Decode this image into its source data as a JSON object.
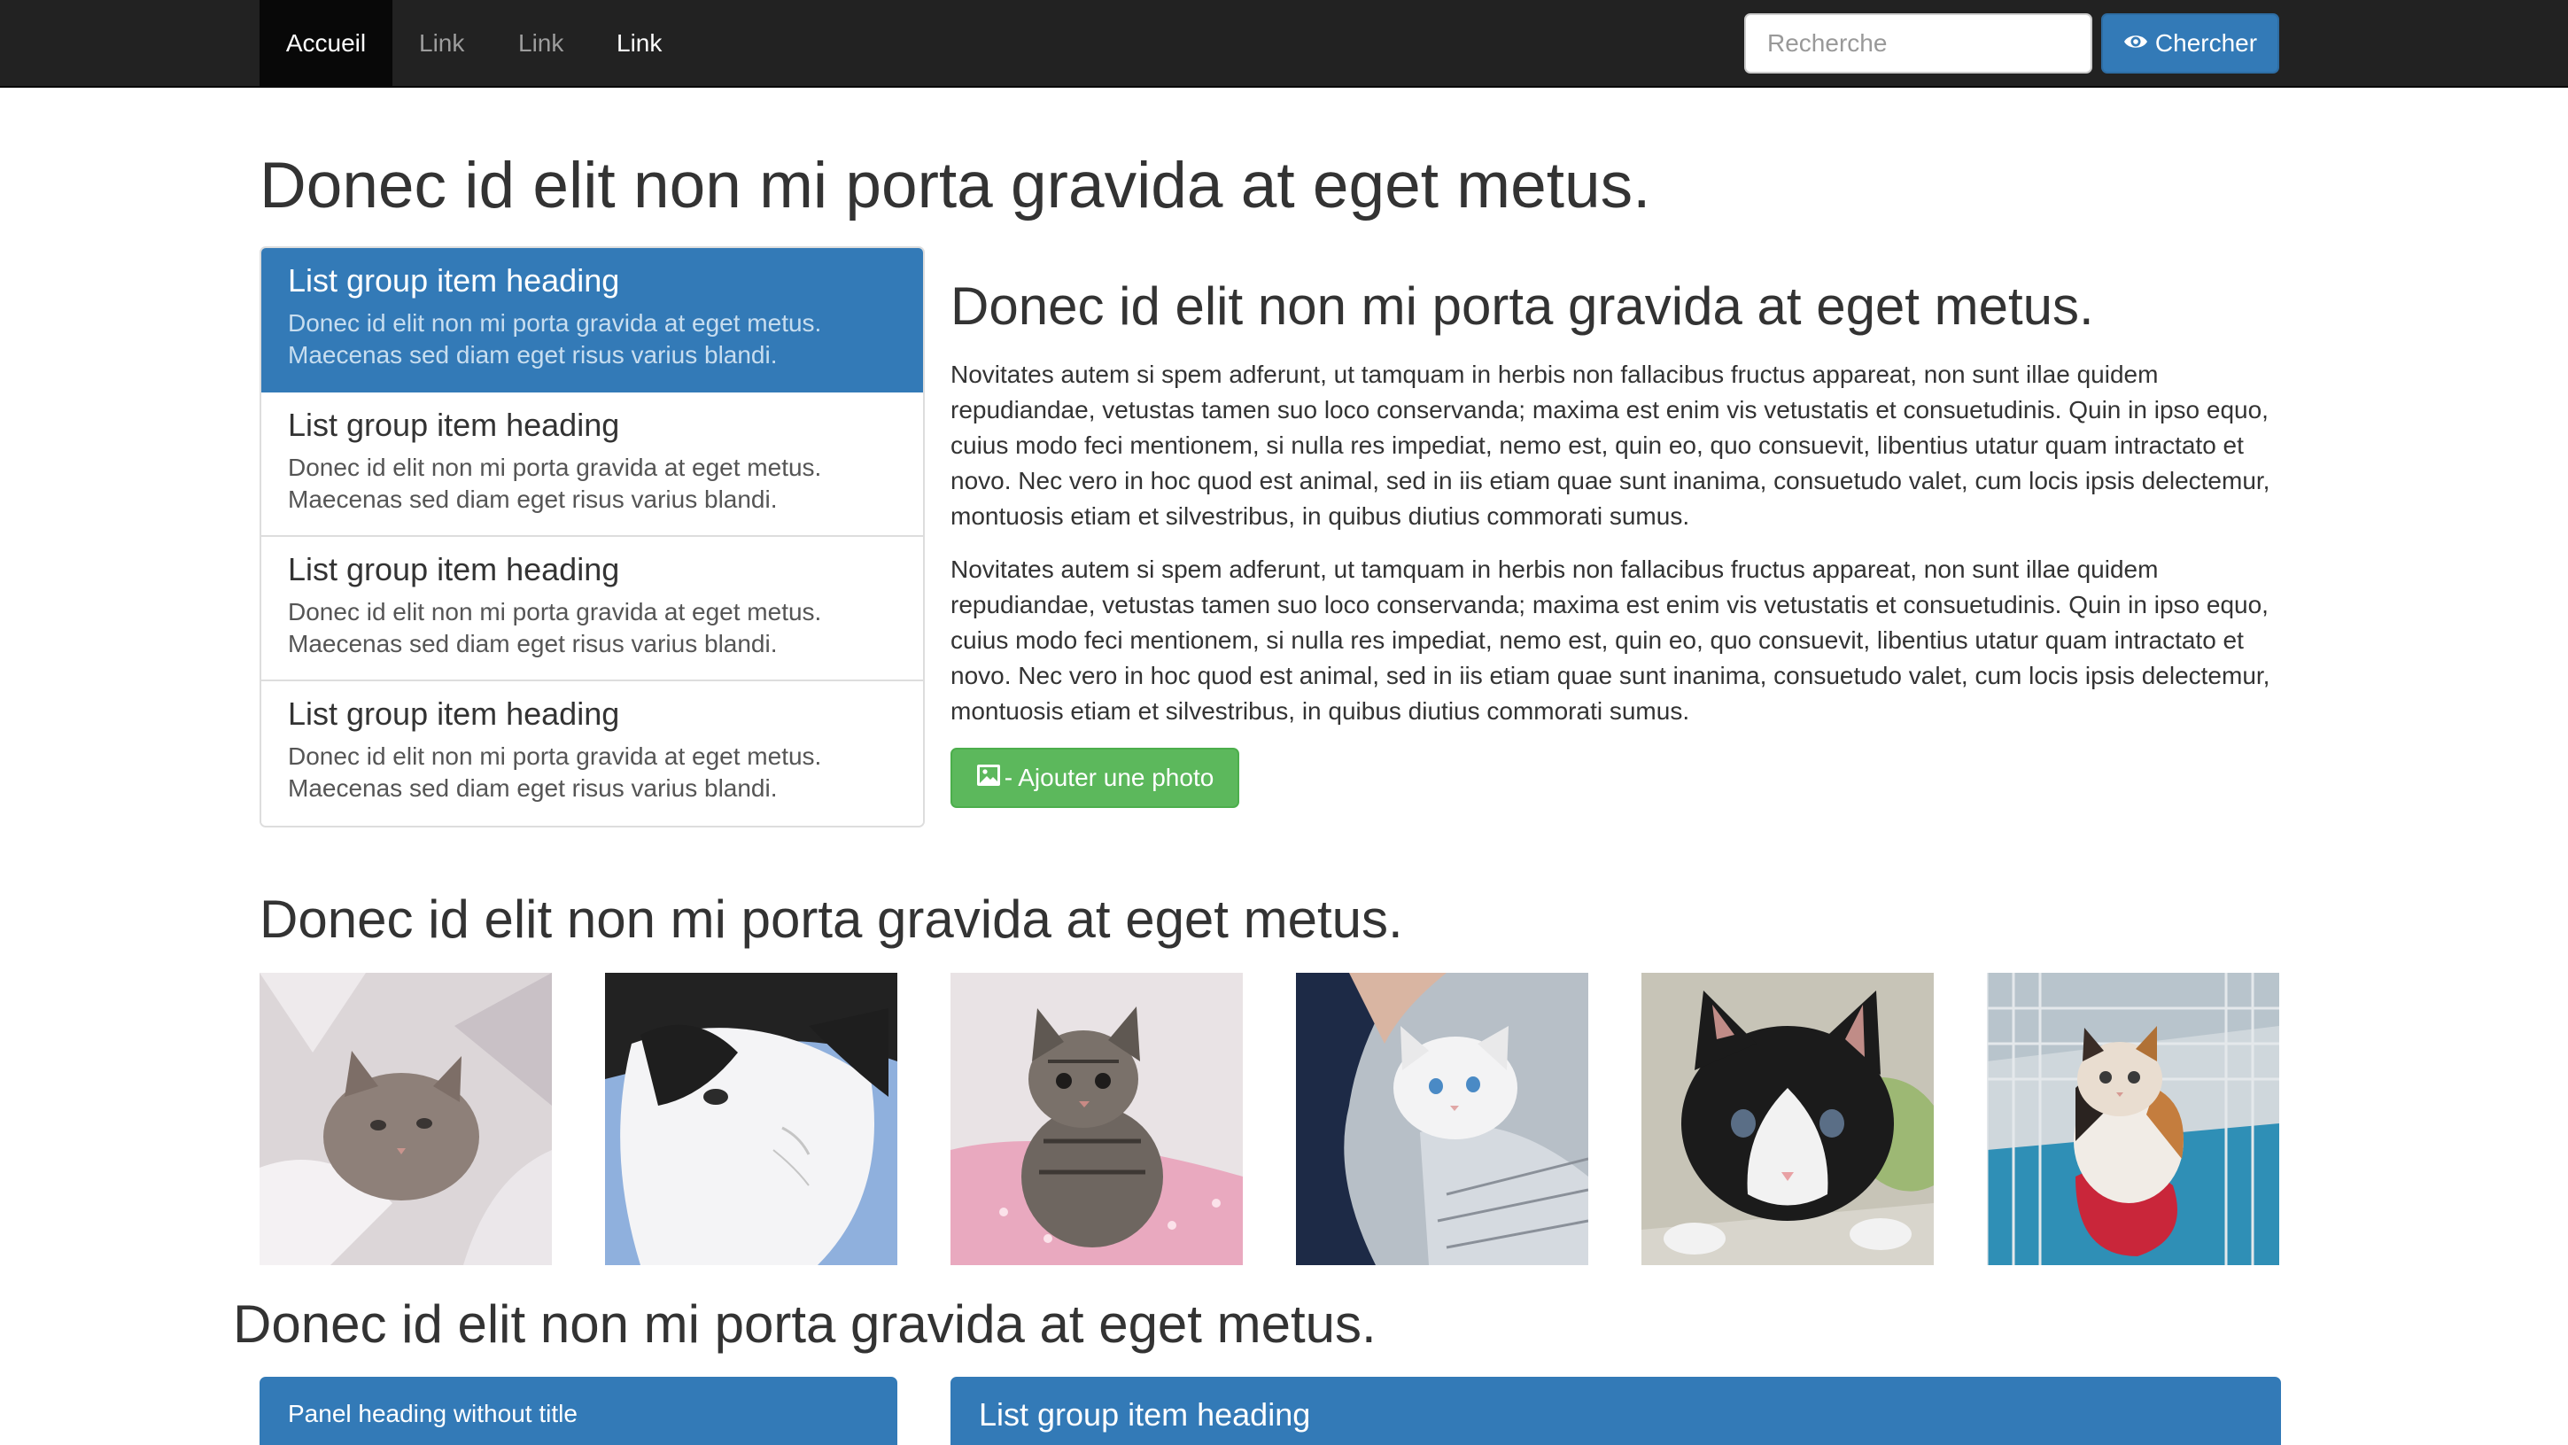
{
  "navbar": {
    "items": [
      {
        "label": "Accueil",
        "active": true
      },
      {
        "label": "Link"
      },
      {
        "label": "Link"
      },
      {
        "label": "Link"
      }
    ],
    "search_placeholder": "Recherche",
    "search_button_label": "Chercher",
    "search_button_icon": "eye-icon"
  },
  "page_title": "Donec id elit non mi porta gravida at eget metus.",
  "list_group": {
    "items": [
      {
        "heading": "List group item heading",
        "text": "Donec id elit non mi porta gravida at eget metus. Maecenas sed diam eget risus varius blandi.",
        "active": true
      },
      {
        "heading": "List group item heading",
        "text": "Donec id elit non mi porta gravida at eget metus. Maecenas sed diam eget risus varius blandi."
      },
      {
        "heading": "List group item heading",
        "text": "Donec id elit non mi porta gravida at eget metus. Maecenas sed diam eget risus varius blandi."
      },
      {
        "heading": "List group item heading",
        "text": "Donec id elit non mi porta gravida at eget metus. Maecenas sed diam eget risus varius blandi."
      }
    ]
  },
  "article": {
    "heading": "Donec id elit non mi porta gravida at eget metus.",
    "paragraphs": [
      "Novitates autem si spem adferunt, ut tamquam in herbis non fallacibus fructus appareat, non sunt illae quidem repudiandae, vetustas tamen suo loco conservanda; maxima est enim vis vetustatis et consuetudinis. Quin in ipso equo, cuius modo feci mentionem, si nulla res impediat, nemo est, quin eo, quo consuevit, libentius utatur quam intractato et novo. Nec vero in hoc quod est animal, sed in iis etiam quae sunt inanima, consuetudo valet, cum locis ipsis delectemur, montuosis etiam et silvestribus, in quibus diutius commorati sumus.",
      "Novitates autem si spem adferunt, ut tamquam in herbis non fallacibus fructus appareat, non sunt illae quidem repudiandae, vetustas tamen suo loco conservanda; maxima est enim vis vetustatis et consuetudinis. Quin in ipso equo, cuius modo feci mentionem, si nulla res impediat, nemo est, quin eo, quo consuevit, libentius utatur quam intractato et novo. Nec vero in hoc quod est animal, sed in iis etiam quae sunt inanima, consuetudo valet, cum locis ipsis delectemur, montuosis etiam et silvestribus, in quibus diutius commorati sumus."
    ],
    "add_photo_label": "- Ajouter une photo",
    "add_photo_icon": "picture-icon"
  },
  "gallery": {
    "heading": "Donec id elit non mi porta gravida at eget metus.",
    "photos": [
      {
        "icon": "cat-photo"
      },
      {
        "icon": "cat-photo"
      },
      {
        "icon": "cat-photo"
      },
      {
        "icon": "cat-photo"
      },
      {
        "icon": "cat-photo"
      },
      {
        "icon": "cat-photo"
      }
    ]
  },
  "bottom": {
    "heading": "Donec id elit non mi porta gravida at eget metus.",
    "panel_heading": "Panel heading without title",
    "list_group_heading": "List group item heading"
  },
  "colors": {
    "navbar_bg": "#222222",
    "primary": "#337ab7",
    "success": "#5cb85c",
    "text": "#333333"
  }
}
